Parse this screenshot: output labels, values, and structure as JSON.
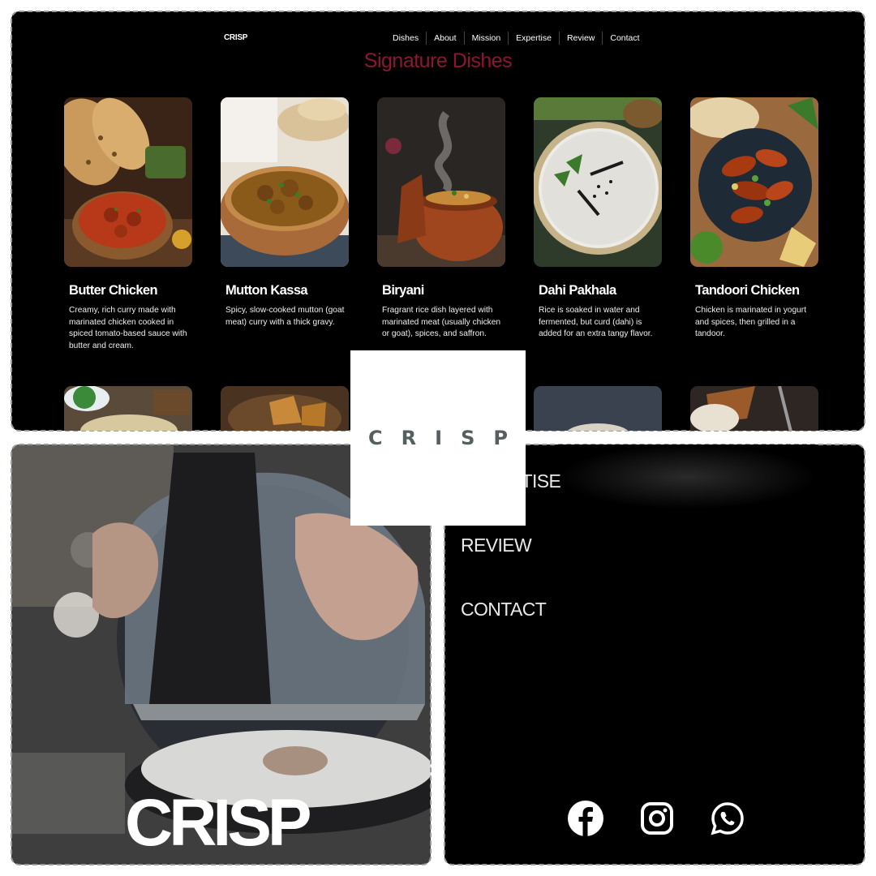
{
  "badge": {
    "text": "CRISP"
  },
  "site": {
    "logo": "CRISP",
    "nav": [
      "Dishes",
      "About",
      "Mission",
      "Expertise",
      "Review",
      "Contact"
    ],
    "section_title": "Signature Dishes",
    "accent_color": "#8d1731",
    "dishes": [
      {
        "name": "Butter Chicken",
        "description": "Creamy, rich curry made with marinated chicken cooked in spiced tomato-based sauce with butter and cream."
      },
      {
        "name": "Mutton Kassa",
        "description": "Spicy, slow-cooked mutton (goat meat) curry with a thick gravy."
      },
      {
        "name": "Biryani",
        "description": "Fragrant rice dish layered with marinated meat (usually chicken or goat), spices, and saffron."
      },
      {
        "name": "Dahi Pakhala",
        "description": "Rice is soaked in water and fermented, but curd (dahi) is added for an extra tangy flavor."
      },
      {
        "name": "Tandoori Chicken",
        "description": "Chicken is marinated in yogurt and spices, then grilled in a tandoor."
      }
    ]
  },
  "video": {
    "logo_text": "CRISP"
  },
  "menu": {
    "items": [
      "EXPERTISE",
      "REVIEW",
      "CONTACT"
    ],
    "social": [
      "facebook-icon",
      "instagram-icon",
      "whatsapp-icon"
    ]
  }
}
